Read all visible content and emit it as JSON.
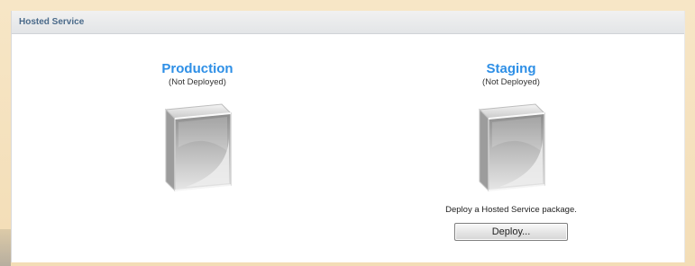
{
  "panel": {
    "title": "Hosted Service"
  },
  "production": {
    "title": "Production",
    "status": "(Not Deployed)",
    "icon": "empty-cube-icon"
  },
  "staging": {
    "title": "Staging",
    "status": "(Not Deployed)",
    "icon": "empty-cube-icon",
    "hint": "Deploy a Hosted Service package.",
    "deploy_label": "Deploy..."
  },
  "colors": {
    "env_title": "#2e8fe6",
    "header_title": "#4a6a8a",
    "background": "#f5e2c0"
  }
}
